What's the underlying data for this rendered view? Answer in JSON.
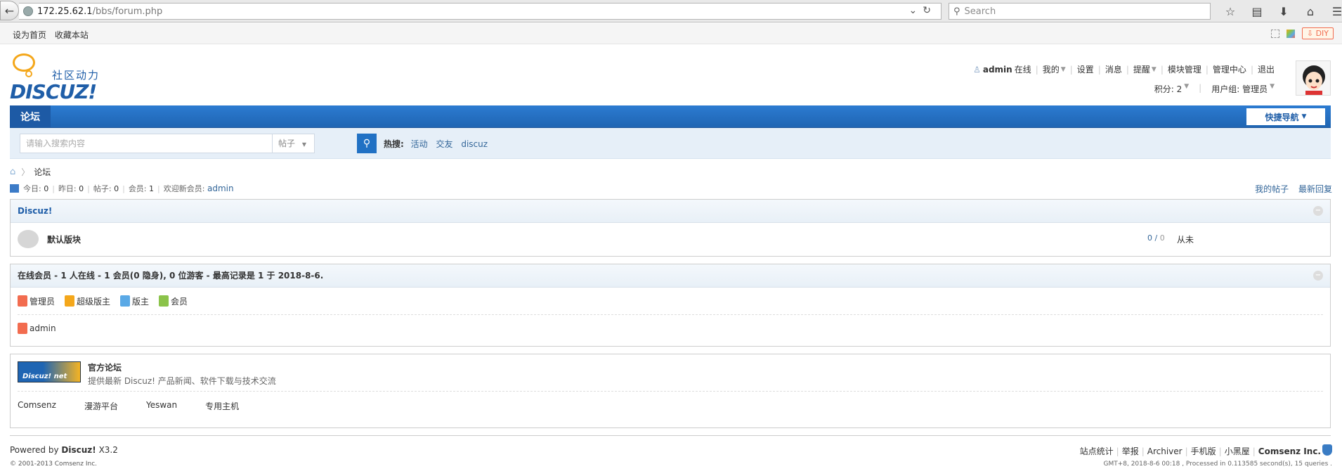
{
  "browser": {
    "url_host": "172.25.62.1",
    "url_path": "/bbs/forum.php",
    "search_placeholder": "Search"
  },
  "topnav": {
    "set_home": "设为首页",
    "bookmark": "收藏本站",
    "diy": "DIY"
  },
  "logo": {
    "slogan": "社区动力",
    "wordmark": "DISCUZ!"
  },
  "user": {
    "name": "admin",
    "status": "在线",
    "menu": [
      "我的",
      "设置",
      "消息",
      "提醒",
      "模块管理",
      "管理中心",
      "退出"
    ],
    "credits": "积分: 2",
    "group": "用户组: 管理员"
  },
  "nav": {
    "home": "论坛",
    "quick": "快捷导航"
  },
  "search": {
    "placeholder": "请输入搜索内容",
    "type": "帖子",
    "hot_label": "热搜:",
    "hot": [
      "活动",
      "交友",
      "discuz"
    ]
  },
  "breadcrumb": {
    "current": "论坛"
  },
  "stats": {
    "today_label": "今日:",
    "today": "0",
    "yesterday_label": "昨日:",
    "yesterday": "0",
    "posts_label": "帖子:",
    "posts": "0",
    "members_label": "会员:",
    "members": "1",
    "welcome_label": "欢迎新会员:",
    "newest": "admin",
    "my_posts": "我的帖子",
    "latest": "最新回复"
  },
  "category": {
    "title": "Discuz!",
    "forum_name": "默认版块",
    "threads": "0",
    "posts": "0",
    "last_post": "从未"
  },
  "online": {
    "title": "在线会员 - 1 人在线 - 1 会员(0 隐身), 0 位游客 - 最高记录是 1 于 2018-8-6.",
    "legend": [
      {
        "label": "管理员",
        "color": "#f26c4f"
      },
      {
        "label": "超级版主",
        "color": "#f4a71b"
      },
      {
        "label": "版主",
        "color": "#5aa9e6"
      },
      {
        "label": "会员",
        "color": "#8bc34a"
      }
    ],
    "member": "admin"
  },
  "links": {
    "logo_text": "Discuz! net",
    "title": "官方论坛",
    "desc": "提供最新 Discuz! 产品新闻、软件下载与技术交流",
    "text_links": [
      "Comsenz",
      "漫游平台",
      "Yeswan",
      "专用主机"
    ]
  },
  "footer": {
    "powered_label": "Powered by",
    "product": "Discuz!",
    "version": "X3.2",
    "copyright": "© 2001-2013 Comsenz Inc.",
    "links": [
      "站点统计",
      "举报",
      "Archiver",
      "手机版",
      "小黑屋"
    ],
    "company": "Comsenz Inc.",
    "time": "GMT+8, 2018-8-6 00:18 , Processed in 0.113585 second(s), 15 queries ."
  }
}
